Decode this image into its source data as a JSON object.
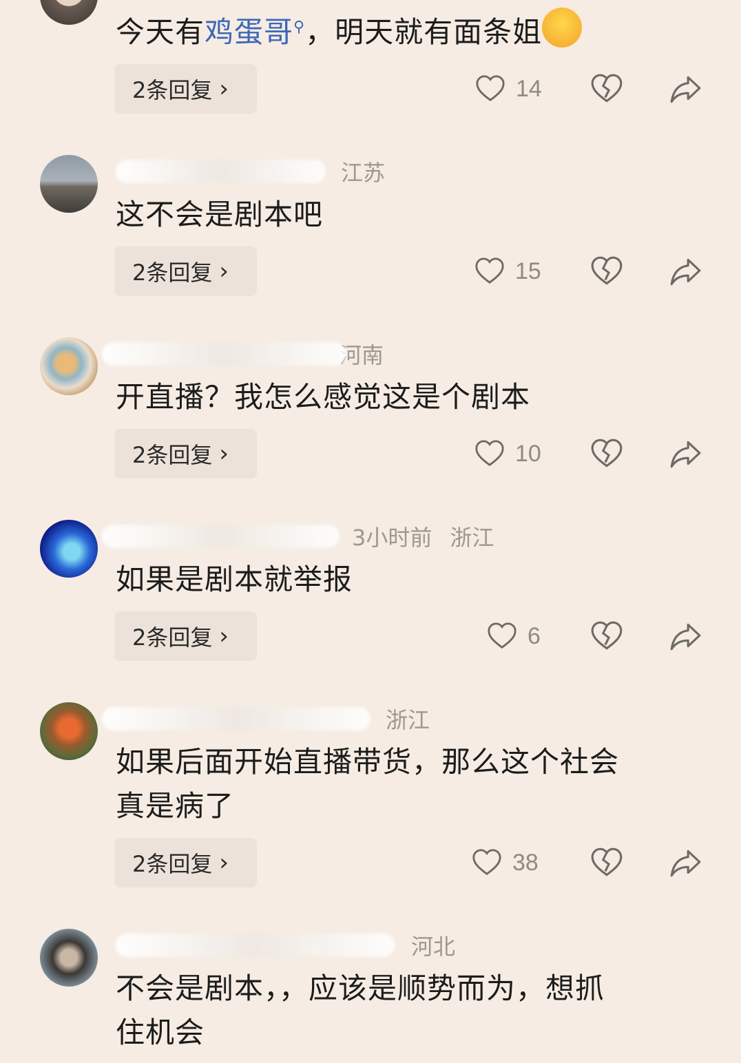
{
  "comments": [
    {
      "region": "",
      "text_prefix": "今天有",
      "text_link": "鸡蛋哥",
      "text_suffix": "，明天就有面条姐",
      "emoji": "laughing-crying-emoji",
      "reply_label": "2条回复",
      "likes": "14"
    },
    {
      "region": "江苏",
      "text": "这不会是剧本吧",
      "reply_label": "2条回复",
      "likes": "15"
    },
    {
      "region": "河南",
      "text": "开直播？我怎么感觉这是个剧本",
      "reply_label": "2条回复",
      "likes": "10"
    },
    {
      "region_time": "3小时前",
      "region": "浙江",
      "text": "如果是剧本就举报",
      "reply_label": "2条回复",
      "likes": "6"
    },
    {
      "region": "浙江",
      "text_line1": "如果后面开始直播带货，那么这个社会",
      "text_line2": "真是病了",
      "reply_label": "2条回复",
      "likes": "38"
    },
    {
      "region": "河北",
      "text_line1": "不会是剧本，，应该是顺势而为，想抓",
      "text_line2": "住机会"
    }
  ],
  "icons": {
    "like": "heart-outline-icon",
    "dislike": "broken-heart-icon",
    "share": "share-arrow-icon",
    "chevron": "chevron-right-icon",
    "search": "search-icon"
  }
}
